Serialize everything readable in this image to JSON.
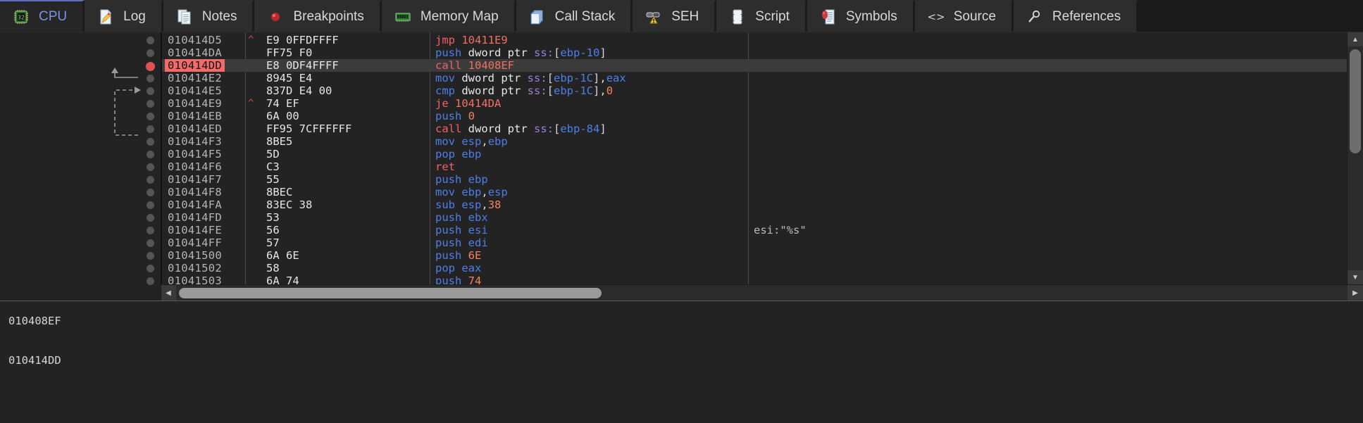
{
  "window": {
    "app": "x32dbg"
  },
  "tabs": [
    {
      "label": "CPU",
      "icon": "cpu-chip-icon",
      "active": true
    },
    {
      "label": "Log",
      "icon": "log-document-icon",
      "active": false
    },
    {
      "label": "Notes",
      "icon": "notes-pages-icon",
      "active": false
    },
    {
      "label": "Breakpoints",
      "icon": "breakpoint-dot-icon",
      "active": false
    },
    {
      "label": "Memory Map",
      "icon": "memory-ram-icon",
      "active": false
    },
    {
      "label": "Call Stack",
      "icon": "call-stack-icon",
      "active": false
    },
    {
      "label": "SEH",
      "icon": "seh-chain-warning-icon",
      "active": false
    },
    {
      "label": "Script",
      "icon": "script-scroll-icon",
      "active": false
    },
    {
      "label": "Symbols",
      "icon": "symbols-book-icon",
      "active": false
    },
    {
      "label": "Source",
      "icon": "source-angle-brackets-icon",
      "active": false
    },
    {
      "label": "References",
      "icon": "references-magnifier-icon",
      "active": false
    }
  ],
  "disassembly": {
    "selected_address": "010414DD",
    "breakpoint_address": "010414DD",
    "rows": [
      {
        "address": "010414D5",
        "jump": "^",
        "bytes": "E9 0FFDFFFF",
        "mnemonic": "jmp",
        "mtype": "branch",
        "operands": [
          {
            "t": "10411E9",
            "c": "num"
          }
        ],
        "comment": "",
        "bp": "none",
        "selected": false
      },
      {
        "address": "010414DA",
        "jump": "",
        "bytes": "FF75 F0",
        "mnemonic": "push",
        "mtype": "std",
        "operands": [
          {
            "t": "dword ptr ",
            "c": "kw"
          },
          {
            "t": "ss:",
            "c": "seg"
          },
          {
            "t": "[",
            "c": "brk"
          },
          {
            "t": "ebp-10",
            "c": "reg"
          },
          {
            "t": "]",
            "c": "brk"
          }
        ],
        "comment": "",
        "bp": "none",
        "selected": false
      },
      {
        "address": "010414DD",
        "jump": "",
        "bytes": "E8 0DF4FFFF",
        "mnemonic": "call",
        "mtype": "branch",
        "operands": [
          {
            "t": "10408EF",
            "c": "num"
          }
        ],
        "comment": "",
        "bp": "set",
        "selected": true
      },
      {
        "address": "010414E2",
        "jump": "",
        "bytes": "8945 E4",
        "mnemonic": "mov",
        "mtype": "std",
        "operands": [
          {
            "t": "dword ptr ",
            "c": "kw"
          },
          {
            "t": "ss:",
            "c": "seg"
          },
          {
            "t": "[",
            "c": "brk"
          },
          {
            "t": "ebp-1C",
            "c": "reg"
          },
          {
            "t": "]",
            "c": "brk"
          },
          {
            "t": ",",
            "c": "brk"
          },
          {
            "t": "eax",
            "c": "reg"
          }
        ],
        "comment": "",
        "bp": "none",
        "selected": false
      },
      {
        "address": "010414E5",
        "jump": "",
        "bytes": "837D E4 00",
        "mnemonic": "cmp",
        "mtype": "std",
        "operands": [
          {
            "t": "dword ptr ",
            "c": "kw"
          },
          {
            "t": "ss:",
            "c": "seg"
          },
          {
            "t": "[",
            "c": "brk"
          },
          {
            "t": "ebp-1C",
            "c": "reg"
          },
          {
            "t": "]",
            "c": "brk"
          },
          {
            "t": ",",
            "c": "brk"
          },
          {
            "t": "0",
            "c": "imm"
          }
        ],
        "comment": "",
        "bp": "none",
        "selected": false
      },
      {
        "address": "010414E9",
        "jump": "^",
        "bytes": "74 EF",
        "mnemonic": "je",
        "mtype": "branch",
        "operands": [
          {
            "t": "10414DA",
            "c": "num"
          }
        ],
        "comment": "",
        "bp": "none",
        "selected": false
      },
      {
        "address": "010414EB",
        "jump": "",
        "bytes": "6A 00",
        "mnemonic": "push",
        "mtype": "std",
        "operands": [
          {
            "t": "0",
            "c": "imm"
          }
        ],
        "comment": "",
        "bp": "none",
        "selected": false
      },
      {
        "address": "010414ED",
        "jump": "",
        "bytes": "FF95 7CFFFFFF",
        "mnemonic": "call",
        "mtype": "branch",
        "operands": [
          {
            "t": "dword ptr ",
            "c": "kw"
          },
          {
            "t": "ss:",
            "c": "seg"
          },
          {
            "t": "[",
            "c": "brk"
          },
          {
            "t": "ebp-84",
            "c": "reg"
          },
          {
            "t": "]",
            "c": "brk"
          }
        ],
        "comment": "",
        "bp": "none",
        "selected": false
      },
      {
        "address": "010414F3",
        "jump": "",
        "bytes": "8BE5",
        "mnemonic": "mov",
        "mtype": "std",
        "operands": [
          {
            "t": "esp",
            "c": "reg"
          },
          {
            "t": ",",
            "c": "brk"
          },
          {
            "t": "ebp",
            "c": "reg"
          }
        ],
        "comment": "",
        "bp": "none",
        "selected": false
      },
      {
        "address": "010414F5",
        "jump": "",
        "bytes": "5D",
        "mnemonic": "pop",
        "mtype": "std",
        "operands": [
          {
            "t": "ebp",
            "c": "reg"
          }
        ],
        "comment": "",
        "bp": "none",
        "selected": false
      },
      {
        "address": "010414F6",
        "jump": "",
        "bytes": "C3",
        "mnemonic": "ret",
        "mtype": "branch",
        "operands": [],
        "comment": "",
        "bp": "none",
        "selected": false
      },
      {
        "address": "010414F7",
        "jump": "",
        "bytes": "55",
        "mnemonic": "push",
        "mtype": "std",
        "operands": [
          {
            "t": "ebp",
            "c": "reg"
          }
        ],
        "comment": "",
        "bp": "none",
        "selected": false
      },
      {
        "address": "010414F8",
        "jump": "",
        "bytes": "8BEC",
        "mnemonic": "mov",
        "mtype": "std",
        "operands": [
          {
            "t": "ebp",
            "c": "reg"
          },
          {
            "t": ",",
            "c": "brk"
          },
          {
            "t": "esp",
            "c": "reg"
          }
        ],
        "comment": "",
        "bp": "none",
        "selected": false
      },
      {
        "address": "010414FA",
        "jump": "",
        "bytes": "83EC 38",
        "mnemonic": "sub",
        "mtype": "std",
        "operands": [
          {
            "t": "esp",
            "c": "reg"
          },
          {
            "t": ",",
            "c": "brk"
          },
          {
            "t": "38",
            "c": "imm"
          }
        ],
        "comment": "",
        "bp": "none",
        "selected": false
      },
      {
        "address": "010414FD",
        "jump": "",
        "bytes": "53",
        "mnemonic": "push",
        "mtype": "std",
        "operands": [
          {
            "t": "ebx",
            "c": "reg"
          }
        ],
        "comment": "",
        "bp": "none",
        "selected": false
      },
      {
        "address": "010414FE",
        "jump": "",
        "bytes": "56",
        "mnemonic": "push",
        "mtype": "std",
        "operands": [
          {
            "t": "esi",
            "c": "reg"
          }
        ],
        "comment": "esi:\"%s\"",
        "bp": "none",
        "selected": false
      },
      {
        "address": "010414FF",
        "jump": "",
        "bytes": "57",
        "mnemonic": "push",
        "mtype": "std",
        "operands": [
          {
            "t": "edi",
            "c": "reg"
          }
        ],
        "comment": "",
        "bp": "none",
        "selected": false
      },
      {
        "address": "01041500",
        "jump": "",
        "bytes": "6A 6E",
        "mnemonic": "push",
        "mtype": "std",
        "operands": [
          {
            "t": "6E",
            "c": "imm"
          }
        ],
        "comment": "",
        "bp": "none",
        "selected": false
      },
      {
        "address": "01041502",
        "jump": "",
        "bytes": "58",
        "mnemonic": "pop",
        "mtype": "std",
        "operands": [
          {
            "t": "eax",
            "c": "reg"
          }
        ],
        "comment": "",
        "bp": "none",
        "selected": false
      },
      {
        "address": "01041503",
        "jump": "",
        "bytes": "6A 74",
        "mnemonic": "push",
        "mtype": "std",
        "operands": [
          {
            "t": "74",
            "c": "imm"
          }
        ],
        "comment": "",
        "bp": "none",
        "selected": false
      }
    ]
  },
  "log": {
    "lines": [
      "010408EF",
      "",
      "010414DD"
    ]
  },
  "colors": {
    "accent": "#7b92e0",
    "breakpoint": "#e05252",
    "selection": "#3b3b3b",
    "branch": "#f0606a",
    "mnemonic": "#4d7fe8",
    "segment": "#9b7fe0"
  }
}
